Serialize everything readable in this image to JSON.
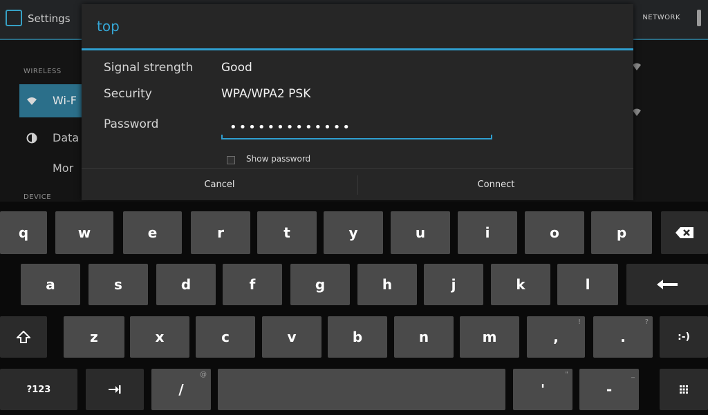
{
  "settings_bg": {
    "app_title": "Settings",
    "action_right": "NETWORK",
    "wireless_header": "WIRELESS",
    "device_header": "DEVICE",
    "items": {
      "wifi": "Wi-F",
      "data": "Data",
      "more": "Mor"
    }
  },
  "dialog": {
    "title": "top",
    "rows": {
      "signal_label": "Signal strength",
      "signal_value": "Good",
      "security_label": "Security",
      "security_value": "WPA/WPA2 PSK",
      "password_label": "Password"
    },
    "password_value": "•••••••••••••",
    "show_password_label": "Show password",
    "cancel_label": "Cancel",
    "connect_label": "Connect"
  },
  "keyboard": {
    "row1": [
      "q",
      "w",
      "e",
      "r",
      "t",
      "y",
      "u",
      "i",
      "o",
      "p"
    ],
    "row2": [
      "a",
      "s",
      "d",
      "f",
      "g",
      "h",
      "j",
      "k",
      "l"
    ],
    "row3": [
      "z",
      "x",
      "c",
      "v",
      "b",
      "n",
      "m",
      ",",
      "."
    ],
    "row3_hints": [
      "",
      "",
      "",
      "",
      "",
      "",
      "",
      "!",
      "?"
    ],
    "symbols_label": "?123",
    "slash_label": "/",
    "slash_hint": "@",
    "apostrophe_label": "'",
    "apostrophe_hint": "\"",
    "dash_label": "-",
    "dash_hint": "_",
    "smiley_label": ":-)"
  },
  "colors": {
    "accent": "#2f9fd0",
    "key_bg": "#4a4a4a",
    "dialog_bg": "#262626"
  }
}
